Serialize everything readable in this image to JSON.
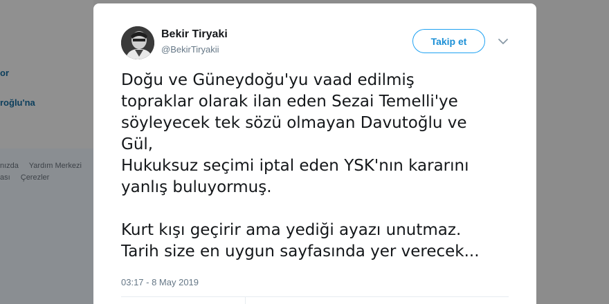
{
  "background": {
    "links": [
      "or",
      "roğlu'na"
    ],
    "footer_row1": [
      "nızda",
      "Yardım Merkezi"
    ],
    "footer_row2": [
      "ası",
      "Çerezler"
    ]
  },
  "tweet": {
    "display_name": "Bekir Tiryaki",
    "username": "@BekirTiryakii",
    "follow_label": "Takip et",
    "text": "Doğu ve Güneydoğu'yu vaad edilmiş\ntopraklar olarak ilan eden Sezai Temelli'ye\nsöyleyecek tek sözü olmayan Davutoğlu ve\nGül,\nHukuksuz seçimi iptal eden YSK'nın kararını\nyanlış buluyormuş.\n\nKurt kışı geçirir ama yediği ayazı unutmaz.\nTarih size en uygun sayfasında yer verecek...",
    "timestamp": "03:17 - 8 May 2019"
  },
  "icons": {
    "avatar": "profile-photo",
    "caret": "chevron-down-icon"
  },
  "colors": {
    "accent": "#1da1f2",
    "text": "#14171a",
    "secondary_text": "#657786",
    "overlay": "#8c8c8c"
  }
}
